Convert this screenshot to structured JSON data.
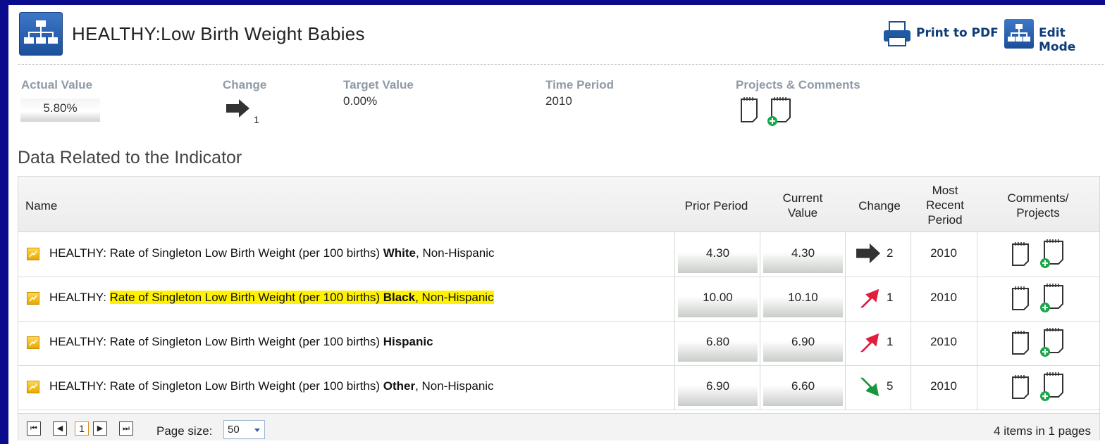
{
  "header": {
    "title": "HEALTHY:Low Birth Weight Babies",
    "print_label": "Print to PDF",
    "edit_label": "Edit Mode"
  },
  "metrics": {
    "actual_label": "Actual Value",
    "actual_value": "5.80%",
    "change_label": "Change",
    "change_value": "1",
    "change_icon": "arrow-right-icon",
    "target_label": "Target Value",
    "target_value": "0.00%",
    "period_label": "Time Period",
    "period_value": "2010",
    "projects_label": "Projects & Comments"
  },
  "section_title": "Data Related to the Indicator",
  "table": {
    "columns": {
      "name": "Name",
      "prior": "Prior Period",
      "current": "Current Value",
      "change": "Change",
      "recent": "Most Recent Period",
      "comments": "Comments/ Projects"
    },
    "rows": [
      {
        "prefix": "HEALTHY: ",
        "middle": "Rate of Singleton Low Birth Weight (per 100 births) ",
        "bold": "White",
        "suffix": ", Non-Hispanic",
        "highlight": false,
        "prior": "4.30",
        "current": "4.30",
        "change_dir": "flat",
        "change_color": "#333333",
        "change": "2",
        "period": "2010"
      },
      {
        "prefix": "HEALTHY: ",
        "middle": "Rate of Singleton Low Birth Weight (per 100 births) ",
        "bold": "Black",
        "suffix": ", Non-Hispanic",
        "highlight": true,
        "prior": "10.00",
        "current": "10.10",
        "change_dir": "up",
        "change_color": "#e31c3d",
        "change": "1",
        "period": "2010"
      },
      {
        "prefix": "HEALTHY: ",
        "middle": "Rate of Singleton Low Birth Weight (per 100 births) ",
        "bold": "Hispanic",
        "suffix": "",
        "highlight": false,
        "prior": "6.80",
        "current": "6.90",
        "change_dir": "up",
        "change_color": "#e31c3d",
        "change": "1",
        "period": "2010"
      },
      {
        "prefix": "HEALTHY: ",
        "middle": "Rate of Singleton Low Birth Weight (per 100 births) ",
        "bold": "Other",
        "suffix": ", Non-Hispanic",
        "highlight": false,
        "prior": "6.90",
        "current": "6.60",
        "change_dir": "down",
        "change_color": "#17973c",
        "change": "5",
        "period": "2010"
      }
    ]
  },
  "pager": {
    "first": "⏮",
    "prev": "◀",
    "current_page": "1",
    "next": "▶",
    "last": "⏭",
    "page_size_label": "Page size:",
    "page_size": "50",
    "summary": "4 items in 1 pages"
  }
}
